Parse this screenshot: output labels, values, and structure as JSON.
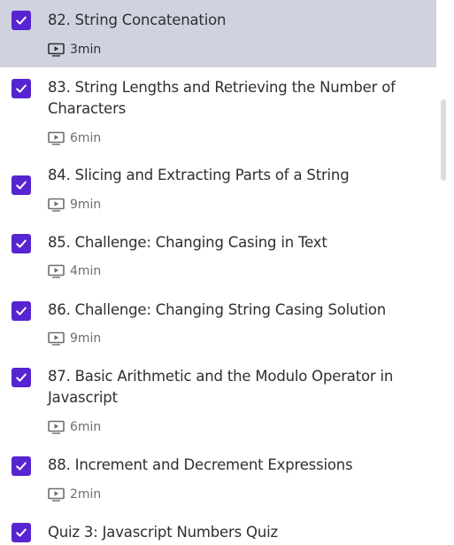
{
  "items": [
    {
      "title": "82. String Concatenation",
      "duration": "3min",
      "completed": true,
      "active": true,
      "type": "video"
    },
    {
      "title": "83. String Lengths and Retrieving the Number of Characters",
      "duration": "6min",
      "completed": true,
      "active": false,
      "type": "video"
    },
    {
      "title": "84. Slicing and Extracting Parts of a String",
      "duration": "9min",
      "completed": true,
      "active": false,
      "type": "video"
    },
    {
      "title": "85. Challenge: Changing Casing in Text",
      "duration": "4min",
      "completed": true,
      "active": false,
      "type": "video"
    },
    {
      "title": "86. Challenge: Changing String Casing Solution",
      "duration": "9min",
      "completed": true,
      "active": false,
      "type": "video"
    },
    {
      "title": "87. Basic Arithmetic and the Modulo Operator in Javascript",
      "duration": "6min",
      "completed": true,
      "active": false,
      "type": "video"
    },
    {
      "title": "88. Increment and Decrement Expressions",
      "duration": "2min",
      "completed": true,
      "active": false,
      "type": "video"
    },
    {
      "title": "Quiz 3: Javascript Numbers Quiz",
      "completed": true,
      "active": false,
      "type": "quiz"
    }
  ],
  "icons": {
    "checkbox": "checkbox-checked-icon",
    "video": "video-play-icon"
  },
  "colors": {
    "accent": "#5624d0",
    "active_background": "#d1d2e0",
    "text": "#2d2f31",
    "muted": "#6a6f73"
  }
}
